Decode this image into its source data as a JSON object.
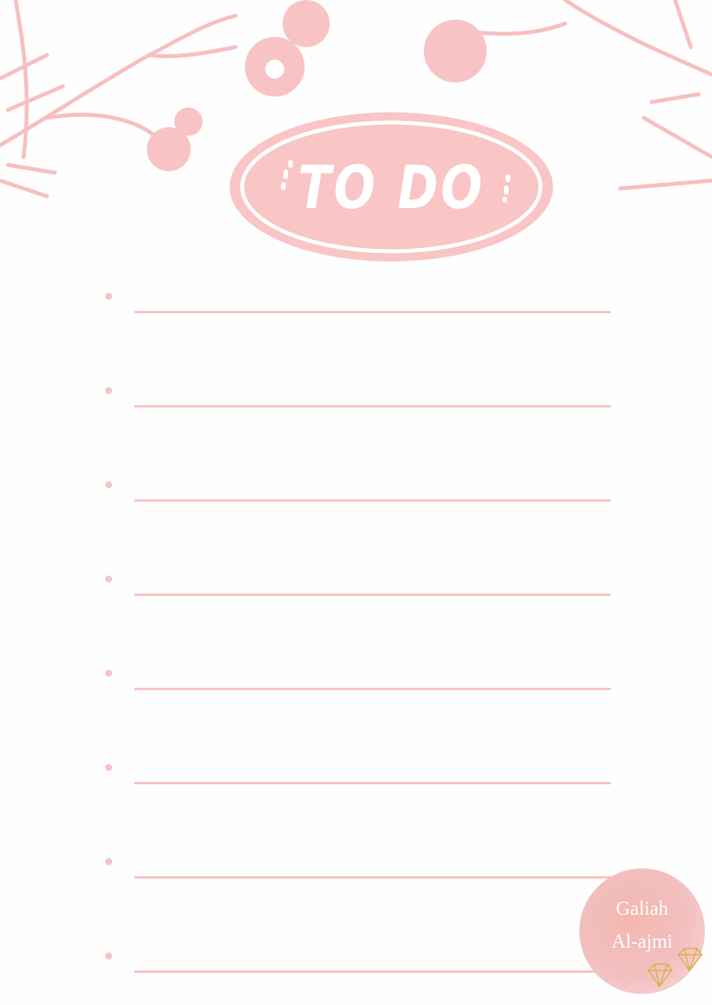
{
  "header": {
    "title": "TO DO"
  },
  "list": {
    "item_count": 8,
    "items": [
      "",
      "",
      "",
      "",
      "",
      "",
      "",
      ""
    ]
  },
  "watermark": {
    "line1": "Galiah",
    "line2": "Al-ajmi"
  },
  "colors": {
    "accent": "#f9c5c5",
    "background": "#fefefe",
    "gold": "#d8b24a"
  }
}
